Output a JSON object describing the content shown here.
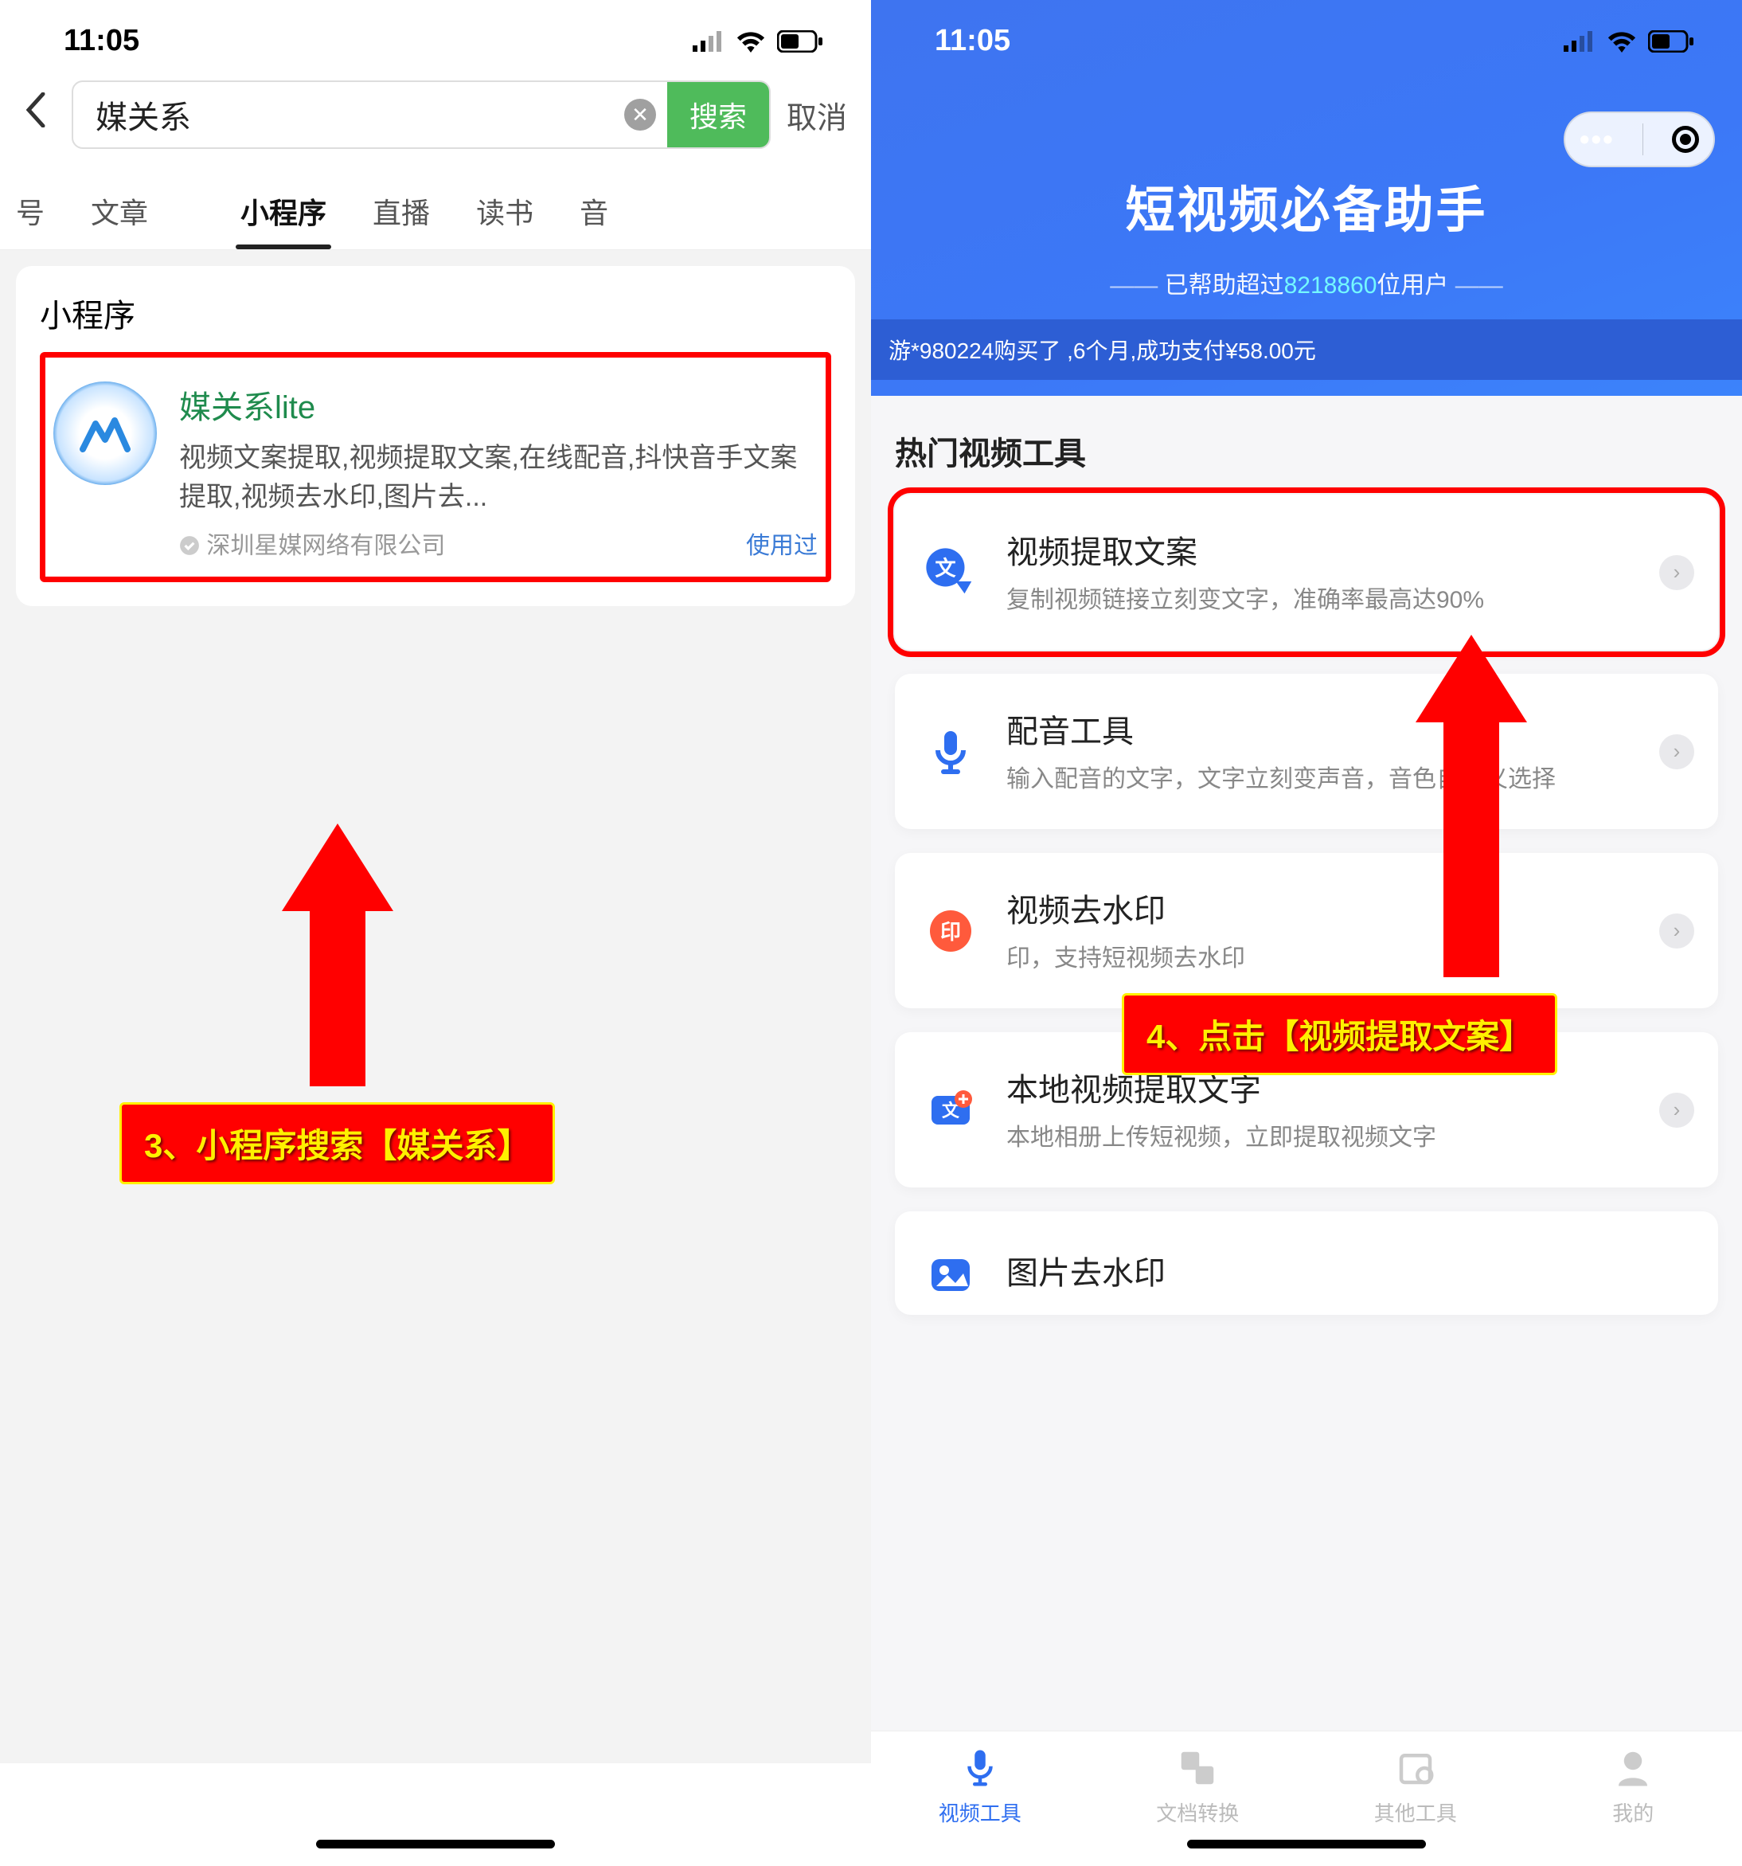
{
  "left": {
    "status_time": "11:05",
    "search": {
      "value": "媒关系",
      "search_btn": "搜索",
      "cancel": "取消"
    },
    "tabs": {
      "t0": "号",
      "t1": "文章",
      "t2": "",
      "t3": "小程序",
      "t4": "直播",
      "t5": "读书",
      "t6": "音"
    },
    "section_title": "小程序",
    "result": {
      "title": "媒关系lite",
      "desc": "视频文案提取,视频提取文案,在线配音,抖快音手文案提取,视频去水印,图片去...",
      "company": "深圳星媒网络有限公司",
      "used": "使用过"
    },
    "annotation": "3、小程序搜索【媒关系】"
  },
  "right": {
    "status_time": "11:05",
    "hero_title": "短视频必备助手",
    "hero_sub_pre": "已帮助超过",
    "hero_sub_count": "8218860",
    "hero_sub_post": "位用户",
    "ticker": "游*980224购买了 ,6个月,成功支付¥58.00元",
    "section_title": "热门视频工具",
    "tools": {
      "t0": {
        "title": "视频提取文案",
        "desc": "复制视频链接立刻变文字，准确率最高达90%"
      },
      "t1": {
        "title": "配音工具",
        "desc": "输入配音的文字，文字立刻变声音，音色自定义选择"
      },
      "t2": {
        "title": "视频去水印",
        "desc": "印，支持短视频去水印"
      },
      "t3": {
        "title": "本地视频提取文字",
        "desc": "本地相册上传短视频，立即提取视频文字"
      },
      "t4": {
        "title": "图片去水印",
        "desc": ""
      }
    },
    "annotation": "4、点击【视频提取文案】",
    "tabbar": {
      "b0": "视频工具",
      "b1": "文档转换",
      "b2": "其他工具",
      "b3": "我的"
    }
  }
}
